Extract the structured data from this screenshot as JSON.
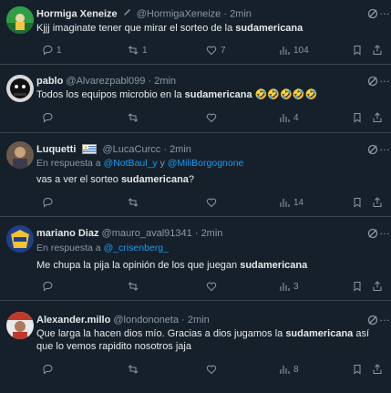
{
  "tweets": [
    {
      "name": "Hormiga Xeneize",
      "handle": "@HormigaXeneize",
      "time": "2min",
      "reply_to_label": "",
      "mentions": [],
      "text_parts": [
        {
          "t": "Kjjj imaginate tener que mirar el sorteo de la ",
          "b": false
        },
        {
          "t": "sudamericana",
          "b": true
        }
      ],
      "counts": {
        "reply": "1",
        "retweet": "1",
        "like": "7",
        "views": "104"
      }
    },
    {
      "name": "pablo",
      "handle": "@Alvarezpabl099",
      "time": "2min",
      "reply_to_label": "",
      "mentions": [],
      "text_parts": [
        {
          "t": "Todos los equipos microbio en la ",
          "b": false
        },
        {
          "t": "sudamericana",
          "b": true
        },
        {
          "t": " 🤣🤣🤣🤣🤣",
          "b": false
        }
      ],
      "counts": {
        "reply": "",
        "retweet": "",
        "like": "",
        "views": "4"
      }
    },
    {
      "name": "Luquetti",
      "handle": "@LucaCurcc",
      "time": "2min",
      "reply_to_label": "En respuesta a",
      "mentions": [
        "@NotBaul_y",
        "@MiliBorgognone"
      ],
      "mention_joiner": "y",
      "text_parts": [
        {
          "t": "vas a ver el sorteo ",
          "b": false
        },
        {
          "t": "sudamericana",
          "b": true
        },
        {
          "t": "?",
          "b": false
        }
      ],
      "counts": {
        "reply": "",
        "retweet": "",
        "like": "",
        "views": "14"
      }
    },
    {
      "name": "mariano Diaz",
      "handle": "@mauro_aval91341",
      "time": "2min",
      "reply_to_label": "En respuesta a",
      "mentions": [
        "@_crisenberg_"
      ],
      "text_parts": [
        {
          "t": "Me chupa la pija la opinión de los que juegan ",
          "b": false
        },
        {
          "t": "sudamericana",
          "b": true
        }
      ],
      "counts": {
        "reply": "",
        "retweet": "",
        "like": "",
        "views": "3"
      }
    },
    {
      "name": "Alexander.millo",
      "handle": "@londononeta",
      "time": "2min",
      "reply_to_label": "",
      "mentions": [],
      "text_parts": [
        {
          "t": "Que larga la hacen dios mío. Gracias a dios jugamos la ",
          "b": false
        },
        {
          "t": "sudamericana",
          "b": true
        },
        {
          "t": " así que lo vemos rapidito nosotros jaja",
          "b": false
        }
      ],
      "counts": {
        "reply": "",
        "retweet": "",
        "like": "",
        "views": "8"
      }
    }
  ],
  "ui": {
    "separator": "·",
    "more_icon": "…",
    "colors": {
      "background": "#15202b",
      "text": "#e7e9ea",
      "muted": "#8b98a5",
      "link": "#1d9bf0",
      "border": "#38444d"
    }
  }
}
